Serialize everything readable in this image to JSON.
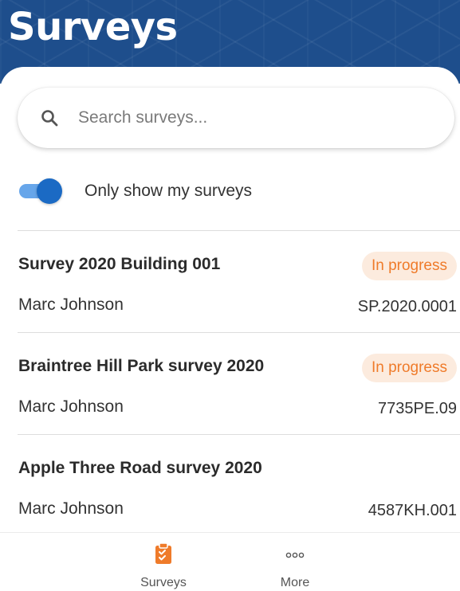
{
  "header": {
    "title": "Surveys"
  },
  "search": {
    "placeholder": "Search surveys...",
    "value": "",
    "icon": "search-icon"
  },
  "filter": {
    "label": "Only show my surveys",
    "enabled": true,
    "accent_color": "#1b6ac4"
  },
  "surveys": [
    {
      "title": "Survey 2020 Building 001",
      "owner": "Marc Johnson",
      "code": "SP.2020.0001",
      "status": "In progress"
    },
    {
      "title": "Braintree Hill Park survey 2020",
      "owner": "Marc Johnson",
      "code": "7735PE.09",
      "status": "In progress"
    },
    {
      "title": "Apple Three Road survey 2020",
      "owner": "Marc Johnson",
      "code": "4587KH.001",
      "status": ""
    }
  ],
  "status_colors": {
    "in_progress_text": "#ef7b2a",
    "in_progress_background": "#fcebde"
  },
  "bottom_nav": {
    "active": "surveys",
    "active_color": "#ef7b2a",
    "items": [
      {
        "id": "surveys",
        "label": "Surveys",
        "icon": "clipboard-check-icon"
      },
      {
        "id": "more",
        "label": "More",
        "icon": "more-dots-icon"
      }
    ]
  }
}
